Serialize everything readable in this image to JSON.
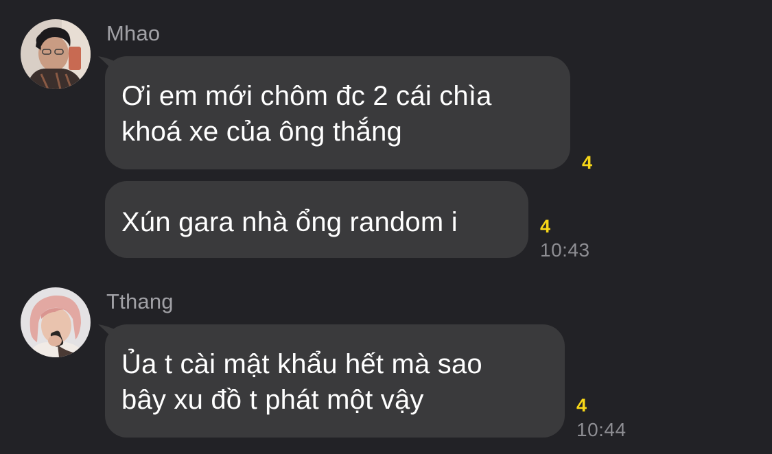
{
  "conversation": {
    "groups": [
      {
        "sender": "Mhao",
        "avatar_icon": "profile-photo-mhao",
        "messages": [
          {
            "lines": [
              "Ơi em mới chôm đc 2 cái chìa",
              "khoá xe của ông thắng"
            ],
            "unread_count": "4",
            "time": ""
          },
          {
            "lines": [
              "Xún gara nhà ổng random i"
            ],
            "unread_count": "4",
            "time": "10:43"
          }
        ]
      },
      {
        "sender": "Tthang",
        "avatar_icon": "profile-photo-tthang",
        "messages": [
          {
            "lines": [
              "Ủa t cài mật khẩu hết mà sao",
              "bây xu đồ t phát một vậy"
            ],
            "unread_count": "4",
            "time": "10:44"
          }
        ]
      }
    ]
  },
  "colors": {
    "background": "#222226",
    "bubble": "#3a3a3c",
    "unread_count": "#f7d718",
    "meta_text": "#8e8e93"
  }
}
